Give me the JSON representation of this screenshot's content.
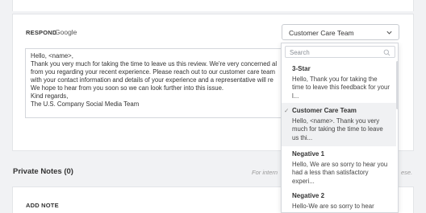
{
  "respond": {
    "label": "RESPOND",
    "platform": "Google",
    "selected_template": "Customer Care Team"
  },
  "reply": {
    "lines": [
      "Hello, <name>,",
      "Thank you very much for taking the time to leave us this review. We're very concerned al",
      "from you regarding your recent experience. Please reach out to our customer care team",
      "with your contact information and details of your experience and a representative will re",
      "We hope to hear from you soon so we can look further into this issue.",
      "Kind regards,",
      "The U.S. Company Social Media Team"
    ]
  },
  "dropdown": {
    "search_placeholder": "Search",
    "items": [
      {
        "title": "3-Star",
        "preview": "Hello, Thank you for taking the time to leave this feedback for your l...",
        "selected": false
      },
      {
        "title": "Customer Care Team",
        "preview": "Hello, <name>. Thank you very much for taking the time to leave us thi...",
        "selected": true
      },
      {
        "title": "Negative 1",
        "preview": "Hello, We are so sorry to hear you had a less than satisfactory experi...",
        "selected": false
      },
      {
        "title": "Negative 2",
        "preview": "Hello-We are so sorry to hear",
        "selected": false
      }
    ]
  },
  "notes": {
    "title": "Private Notes (0)",
    "hint": "For intern",
    "hint_tail": "ese.",
    "add_note_label": "ADD NOTE"
  },
  "icons": {
    "chevron": "chevron-down-icon",
    "search": "search-icon",
    "check": "checkmark-icon"
  }
}
